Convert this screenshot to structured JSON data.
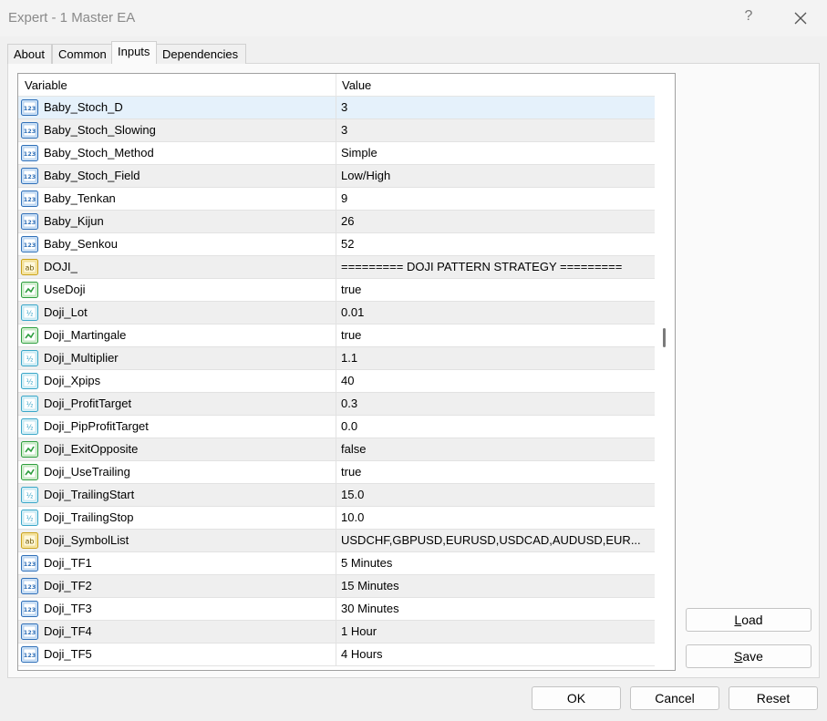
{
  "window": {
    "title": "Expert - 1 Master EA",
    "help_glyph": "?"
  },
  "tabs": [
    {
      "label": "About"
    },
    {
      "label": "Common"
    },
    {
      "label": "Inputs"
    },
    {
      "label": "Dependencies"
    }
  ],
  "active_tab": "Inputs",
  "grid": {
    "headers": {
      "variable": "Variable",
      "value": "Value"
    },
    "rows": [
      {
        "type": "int",
        "variable": "Baby_Stoch_D",
        "value": "3",
        "selected": true
      },
      {
        "type": "int",
        "variable": "Baby_Stoch_Slowing",
        "value": "3"
      },
      {
        "type": "int",
        "variable": "Baby_Stoch_Method",
        "value": "Simple"
      },
      {
        "type": "int",
        "variable": "Baby_Stoch_Field",
        "value": "Low/High"
      },
      {
        "type": "int",
        "variable": "Baby_Tenkan",
        "value": "9"
      },
      {
        "type": "int",
        "variable": "Baby_Kijun",
        "value": "26"
      },
      {
        "type": "int",
        "variable": "Baby_Senkou",
        "value": "52"
      },
      {
        "type": "string",
        "variable": "DOJI_",
        "value": "========= DOJI PATTERN STRATEGY ========="
      },
      {
        "type": "bool",
        "variable": "UseDoji",
        "value": "true"
      },
      {
        "type": "double",
        "variable": "Doji_Lot",
        "value": "0.01"
      },
      {
        "type": "bool",
        "variable": "Doji_Martingale",
        "value": "true"
      },
      {
        "type": "double",
        "variable": "Doji_Multiplier",
        "value": "1.1"
      },
      {
        "type": "double",
        "variable": "Doji_Xpips",
        "value": "40"
      },
      {
        "type": "double",
        "variable": "Doji_ProfitTarget",
        "value": "0.3"
      },
      {
        "type": "double",
        "variable": "Doji_PipProfitTarget",
        "value": "0.0"
      },
      {
        "type": "bool",
        "variable": "Doji_ExitOpposite",
        "value": "false"
      },
      {
        "type": "bool",
        "variable": "Doji_UseTrailing",
        "value": "true"
      },
      {
        "type": "double",
        "variable": "Doji_TrailingStart",
        "value": "15.0"
      },
      {
        "type": "double",
        "variable": "Doji_TrailingStop",
        "value": "10.0"
      },
      {
        "type": "string",
        "variable": "Doji_SymbolList",
        "value": "USDCHF,GBPUSD,EURUSD,USDCAD,AUDUSD,EUR..."
      },
      {
        "type": "int",
        "variable": "Doji_TF1",
        "value": "5 Minutes"
      },
      {
        "type": "int",
        "variable": "Doji_TF2",
        "value": "15 Minutes"
      },
      {
        "type": "int",
        "variable": "Doji_TF3",
        "value": "30 Minutes"
      },
      {
        "type": "int",
        "variable": "Doji_TF4",
        "value": "1 Hour"
      },
      {
        "type": "int",
        "variable": "Doji_TF5",
        "value": "4 Hours"
      }
    ]
  },
  "side_buttons": {
    "load": {
      "pre": "",
      "ul": "L",
      "post": "oad"
    },
    "save": {
      "pre": "",
      "ul": "S",
      "post": "ave"
    }
  },
  "footer_buttons": {
    "ok": "OK",
    "cancel": "Cancel",
    "reset": "Reset"
  },
  "icon_colors": {
    "int": "#2f6fb8",
    "double": "#3aa6c8",
    "bool": "#2e9e3e",
    "string": "#c9a21a"
  }
}
